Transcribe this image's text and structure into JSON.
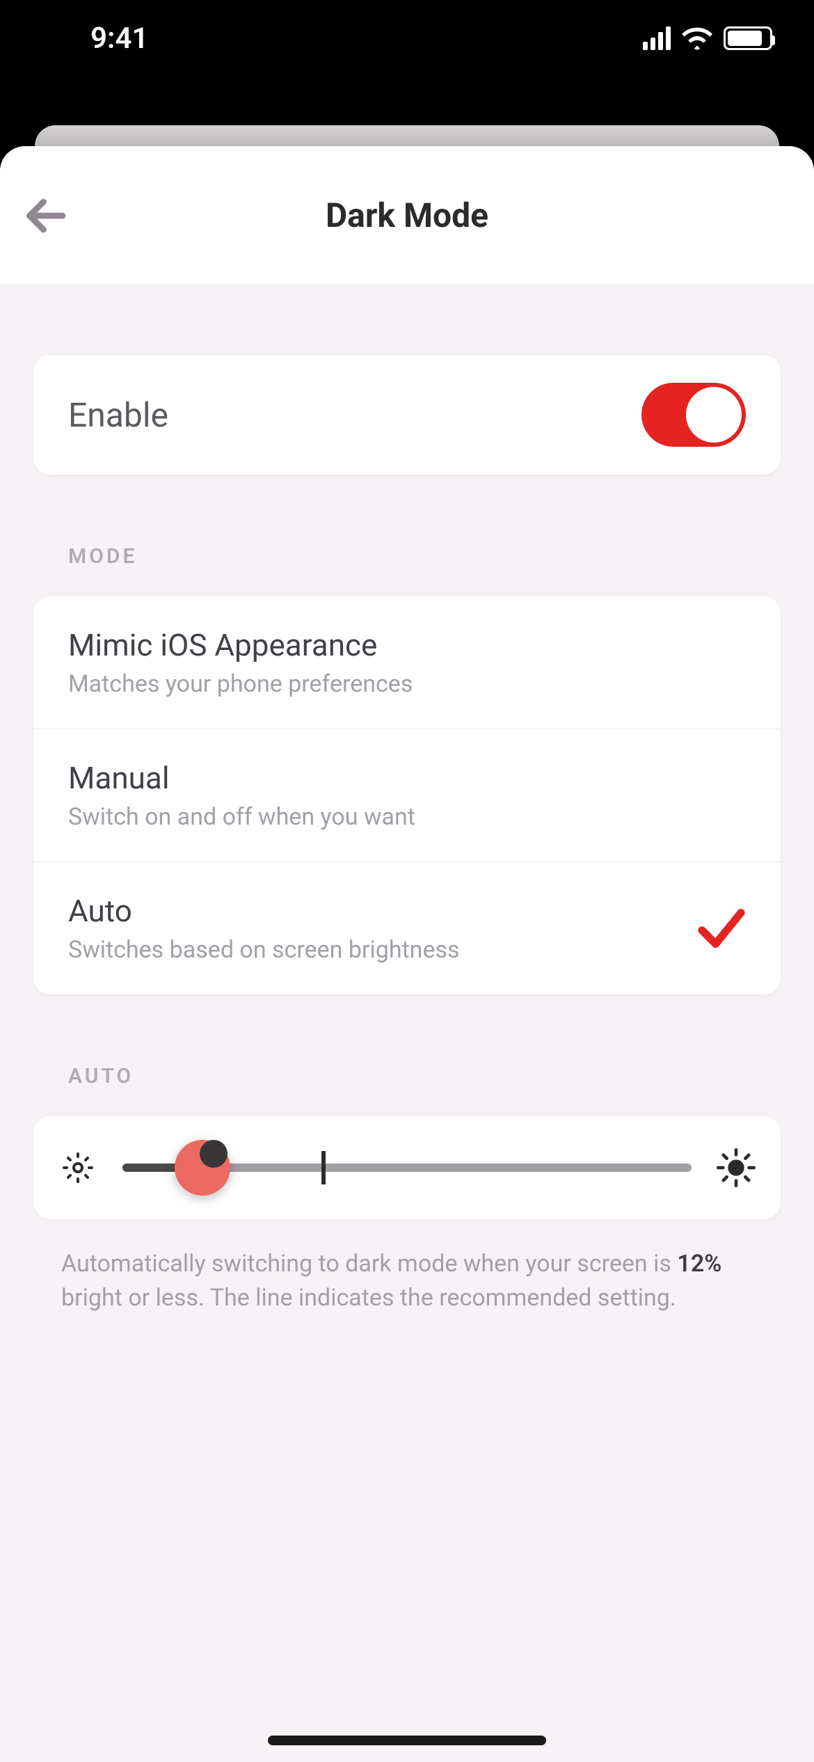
{
  "status": {
    "time": "9:41"
  },
  "header": {
    "title": "Dark Mode"
  },
  "enable": {
    "label": "Enable",
    "value": true
  },
  "sections": {
    "mode_label": "MODE",
    "auto_label": "AUTO"
  },
  "modes": [
    {
      "title": "Mimic iOS Appearance",
      "subtitle": "Matches your phone preferences",
      "selected": false
    },
    {
      "title": "Manual",
      "subtitle": "Switch on and off when you want",
      "selected": false
    },
    {
      "title": "Auto",
      "subtitle": "Switches based on screen brightness",
      "selected": true
    }
  ],
  "auto": {
    "value_percent": 14,
    "tick_percent": 35,
    "value_text": "12%",
    "help_prefix": "Automatically switching to dark mode when your screen is ",
    "help_suffix": " bright or less. The line indicates the recommended setting."
  },
  "colors": {
    "accent": "#e52321"
  }
}
